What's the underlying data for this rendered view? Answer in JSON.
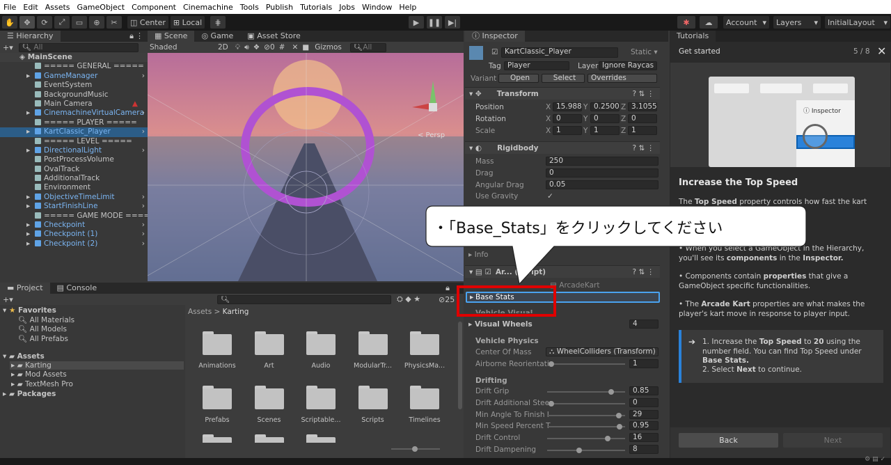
{
  "menu": [
    "File",
    "Edit",
    "Assets",
    "GameObject",
    "Component",
    "Cinemachine",
    "Tools",
    "Publish",
    "Tutorials",
    "Jobs",
    "Window",
    "Help"
  ],
  "toolbar": {
    "center": "Center",
    "local": "Local",
    "account": "Account",
    "layers": "Layers",
    "layout": "InitialLayout"
  },
  "hierarchy": {
    "tab": "Hierarchy",
    "search": "All",
    "scene": "MainScene",
    "items": [
      {
        "label": "===== GENERAL =====",
        "blue": false,
        "arrow": false
      },
      {
        "label": "GameManager",
        "blue": true,
        "arrow": true
      },
      {
        "label": "EventSystem",
        "blue": false,
        "arrow": false
      },
      {
        "label": "BackgroundMusic",
        "blue": false,
        "arrow": false
      },
      {
        "label": "Main Camera",
        "blue": false,
        "arrow": false
      },
      {
        "label": "CinemachineVirtualCamera",
        "blue": true,
        "arrow": true
      },
      {
        "label": "===== PLAYER =====",
        "blue": false,
        "arrow": false
      },
      {
        "label": "KartClassic_Player",
        "blue": true,
        "arrow": true,
        "selected": true
      },
      {
        "label": "===== LEVEL =====",
        "blue": false,
        "arrow": false
      },
      {
        "label": "DirectionalLight",
        "blue": true,
        "arrow": true
      },
      {
        "label": "PostProcessVolume",
        "blue": false,
        "arrow": false
      },
      {
        "label": "OvalTrack",
        "blue": false,
        "arrow": false
      },
      {
        "label": "AdditionalTrack",
        "blue": false,
        "arrow": false
      },
      {
        "label": "Environment",
        "blue": false,
        "arrow": false
      },
      {
        "label": "ObjectiveTimeLimit",
        "blue": true,
        "arrow": true
      },
      {
        "label": "StartFinishLine",
        "blue": true,
        "arrow": true
      },
      {
        "label": "===== GAME MODE =====",
        "blue": false,
        "arrow": false
      },
      {
        "label": "Checkpoint",
        "blue": true,
        "arrow": true
      },
      {
        "label": "Checkpoint (1)",
        "blue": true,
        "arrow": true
      },
      {
        "label": "Checkpoint (2)",
        "blue": true,
        "arrow": true
      }
    ]
  },
  "scene": {
    "tabs": [
      "Scene",
      "Game",
      "Asset Store"
    ],
    "shading": "Shaded",
    "mode2d": "2D",
    "gizmos": "Gizmos",
    "search": "All",
    "persp": "< Persp",
    "layer_count": "0"
  },
  "project": {
    "tabs": [
      "Project",
      "Console"
    ],
    "favorites": "Favorites",
    "fav_items": [
      "All Materials",
      "All Models",
      "All Prefabs"
    ],
    "assets": "Assets",
    "asset_items": [
      "Karting",
      "Mod Assets",
      "TextMesh Pro"
    ],
    "packages": "Packages",
    "breadcrumb": [
      "Assets",
      "Karting"
    ],
    "folders": [
      "Animations",
      "Art",
      "Audio",
      "ModularTr...",
      "PhysicsMa...",
      "Prefabs",
      "Scenes",
      "Scriptable...",
      "Scripts",
      "Timelines"
    ],
    "count": "25"
  },
  "inspector": {
    "tab": "Inspector",
    "object_name": "KartClassic_Player",
    "static": "Static",
    "tag_label": "Tag",
    "tag": "Player",
    "layer_label": "Layer",
    "layer": "Ignore Raycas",
    "variant": "Variant",
    "open": "Open",
    "select": "Select",
    "overrides": "Overrides",
    "transform": {
      "title": "Transform",
      "position": "Position",
      "rotation": "Rotation",
      "scale": "Scale",
      "pos": [
        "15.9889",
        "0.2500",
        "3.1055"
      ],
      "rot": [
        "0",
        "0",
        "0"
      ],
      "scl": [
        "1",
        "1",
        "1"
      ]
    },
    "rigidbody": {
      "title": "Rigidbody",
      "mass_l": "Mass",
      "mass": "250",
      "drag_l": "Drag",
      "drag": "0",
      "adrag_l": "Angular Drag",
      "adrag": "0.05",
      "grav_l": "Use Gravity",
      "grav": "✓"
    },
    "info": "Info",
    "arcade_title": "Ar... (Script)",
    "arcade_script": "ArcadeKart",
    "base_stats": "Base Stats",
    "vehicle_visual": "Vehicle Visual",
    "visual_wheels": "Visual Wheels",
    "vw_count": "4",
    "vehicle_physics": "Vehicle Physics",
    "com_l": "Center Of Mass",
    "com": "WheelColliders (Transform)",
    "airborne_l": "Airborne Reorientati",
    "airborne": "1",
    "drifting": "Drifting",
    "drift_rows": [
      {
        "label": "Drift Grip",
        "value": "0.85",
        "pos": 0.85
      },
      {
        "label": "Drift Additional Steer",
        "value": "0",
        "pos": 0.02
      },
      {
        "label": "Min Angle To Finish I",
        "value": "29",
        "pos": 0.95
      },
      {
        "label": "Min Speed Percent T",
        "value": "0.95",
        "pos": 0.96
      },
      {
        "label": "Drift Control",
        "value": "16",
        "pos": 0.8
      },
      {
        "label": "Drift Dampening",
        "value": "8",
        "pos": 0.4
      }
    ]
  },
  "tutorial": {
    "tab": "Tutorials",
    "title": "Get started",
    "step": "5 / 8",
    "illus_label": "Inspector",
    "heading": "Increase the Top Speed",
    "p1_pre": "The ",
    "p1_b": "Top Speed",
    "p1_post": " property controls how fast the kart moves",
    "p2_pre": "• When you select a GameObject in the Hierarchy, you'll see its ",
    "p2_b": "components",
    "p2_post": " in the ",
    "p2_b2": "Inspector.",
    "p3_pre": "• Components contain ",
    "p3_b": "properties",
    "p3_post": " that give a GameObject specific functionalities.",
    "p4_pre": "• The ",
    "p4_b": "Arcade Kart",
    "p4_post": " properties are what makes the player's kart move in response to player input.",
    "task1_pre": "1. Increase the ",
    "task1_b": "Top Speed",
    "task1_mid": " to ",
    "task1_b2": "20",
    "task1_post": " using the number field. You can find Top Speed under ",
    "task1_b3": "Base Stats.",
    "task2_pre": "2. Select ",
    "task2_b": "Next",
    "task2_post": " to continue.",
    "back": "Back",
    "next": "Next"
  },
  "callout": {
    "text": "・「Base_Stats」をクリックしてください"
  },
  "colors": {
    "accent": "#2a82da",
    "highlight": "#e00000",
    "selection_border": "#4aa3f0"
  }
}
